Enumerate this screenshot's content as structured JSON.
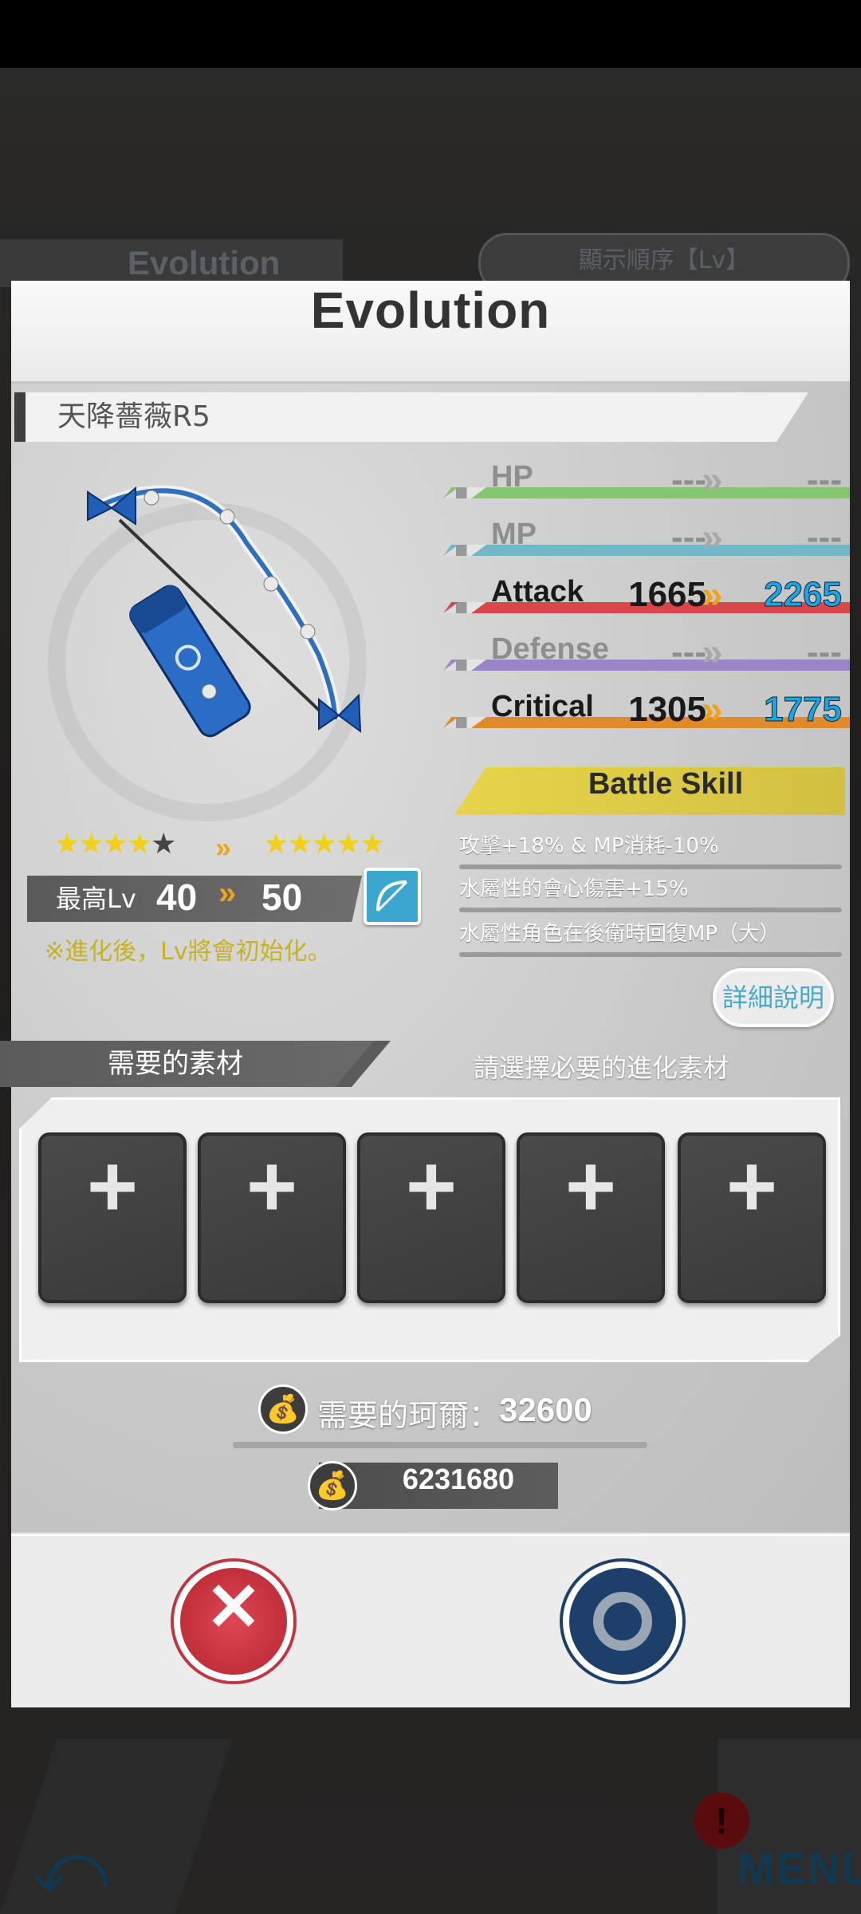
{
  "background": {
    "behind_left_tab": "Evolution",
    "behind_sort_button": "顯示順序【Lv】",
    "menu_label": "MENU",
    "alert_badge": "!"
  },
  "dialog": {
    "title": "Evolution",
    "item_name": "天降薔薇R5",
    "rarity": {
      "before_filled": "★★★★",
      "before_empty": "★",
      "arrow": "»",
      "after": "★★★★★"
    },
    "level": {
      "label": "最高Lv",
      "from": "40",
      "arrow": "»",
      "to": "50"
    },
    "warning": "※進化後，Lv將會初始化。",
    "stats": [
      {
        "label": "HP",
        "from": "---",
        "to": "---",
        "active": false,
        "color": "#86c66e"
      },
      {
        "label": "MP",
        "from": "---",
        "to": "---",
        "active": false,
        "color": "#6fb7c9"
      },
      {
        "label": "Attack",
        "from": "1665",
        "to": "2265",
        "active": true,
        "color": "#d9474a"
      },
      {
        "label": "Defense",
        "from": "---",
        "to": "---",
        "active": false,
        "color": "#9a86c7"
      },
      {
        "label": "Critical",
        "from": "1305",
        "to": "1775",
        "active": true,
        "color": "#e08a2c"
      }
    ],
    "battle_skill": {
      "header": "Battle Skill",
      "lines": [
        "攻擊+18% & MP消耗-10%",
        "水屬性的會心傷害+15%",
        "水屬性角色在後衛時回復MP（大）"
      ]
    },
    "detail_button": "詳細說明",
    "materials": {
      "tab_label": "需要的素材",
      "hint": "請選擇必要的進化素材",
      "slot_symbol": "+"
    },
    "cost": {
      "label": "需要的珂爾：",
      "value": "32600",
      "balance": "6231680"
    },
    "cancel_symbol": "✕"
  }
}
